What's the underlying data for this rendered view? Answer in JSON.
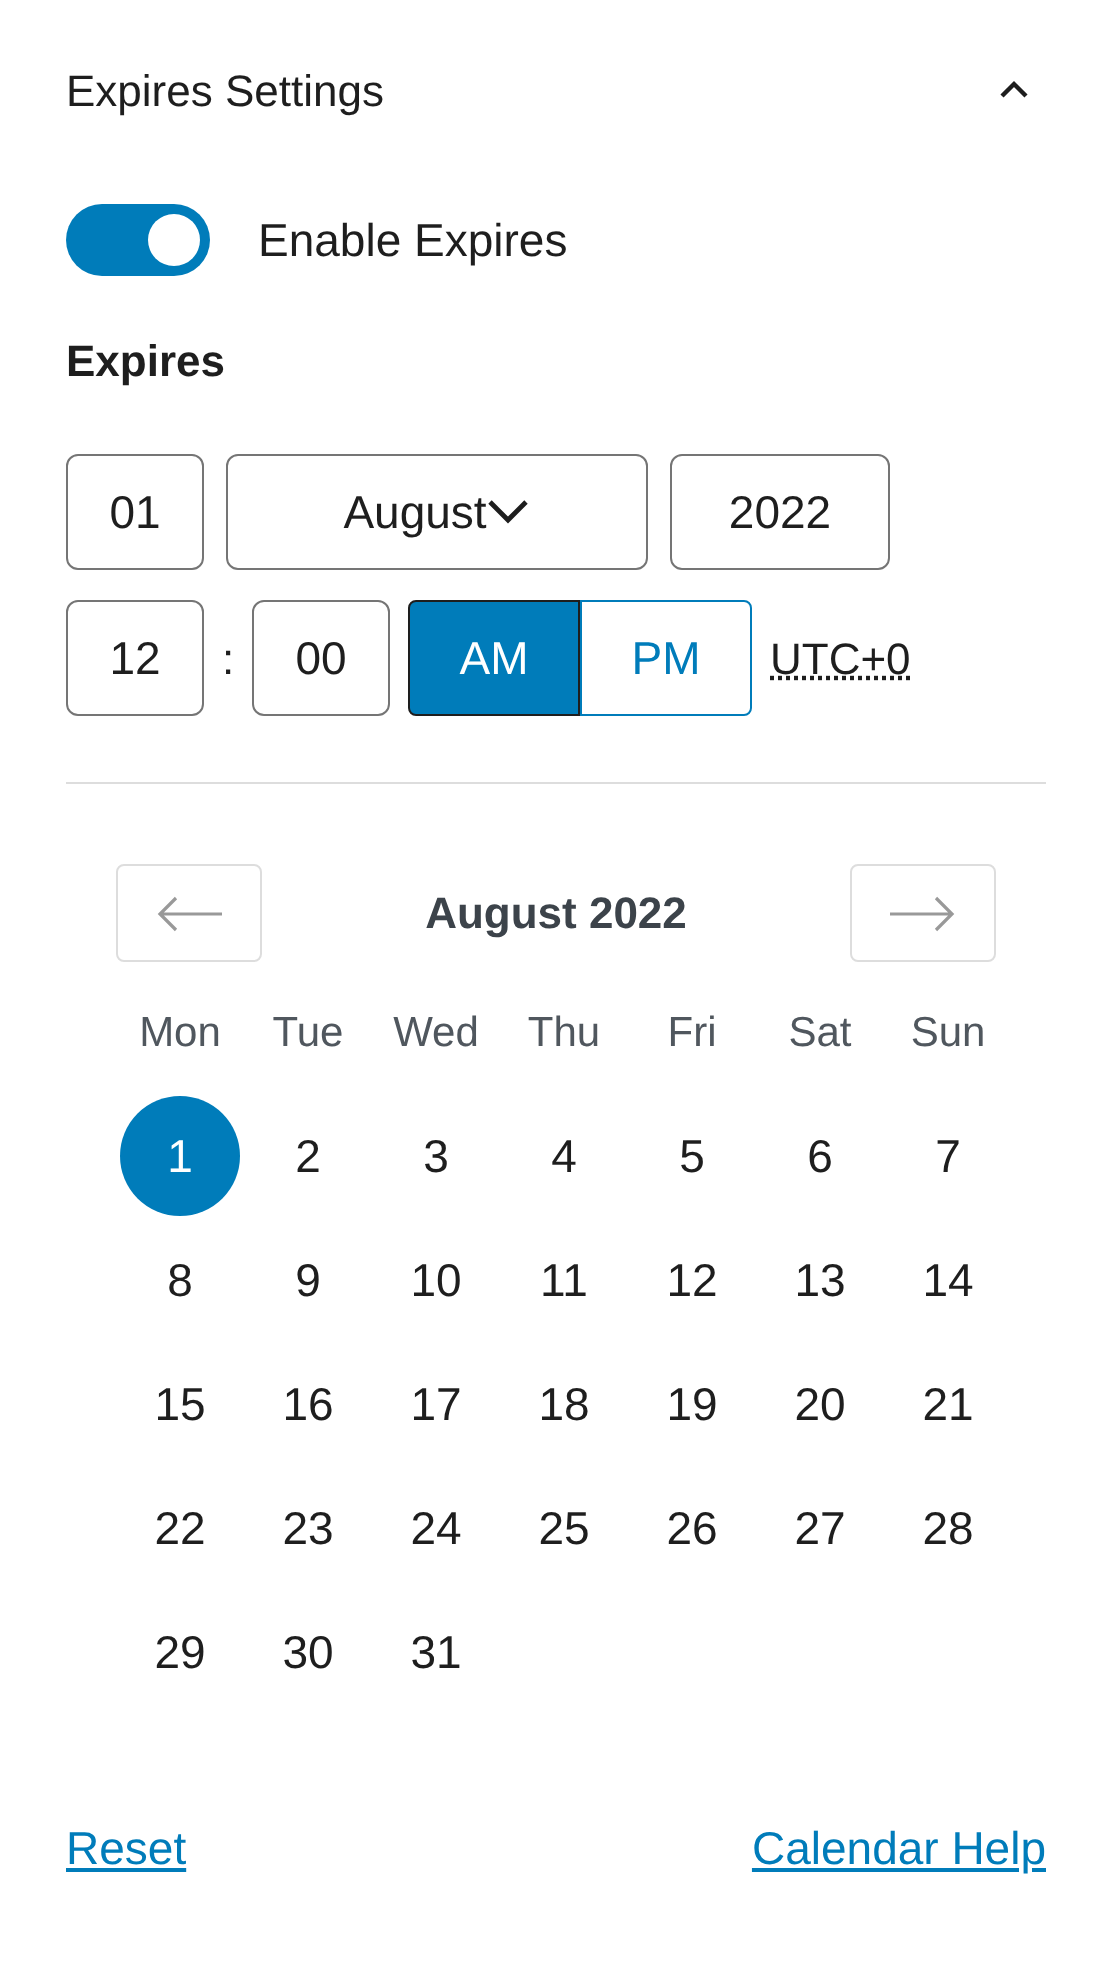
{
  "panel": {
    "title": "Expires Settings",
    "expanded": true
  },
  "toggle": {
    "label": "Enable Expires",
    "on": true
  },
  "section_label": "Expires",
  "date": {
    "day": "01",
    "month": "August",
    "year": "2022"
  },
  "time": {
    "hour": "12",
    "separator": ":",
    "minute": "00",
    "periods": [
      {
        "label": "AM",
        "selected": true
      },
      {
        "label": "PM",
        "selected": false
      }
    ],
    "timezone": "UTC+0"
  },
  "calendar": {
    "title": "August 2022",
    "weekdays": [
      "Mon",
      "Tue",
      "Wed",
      "Thu",
      "Fri",
      "Sat",
      "Sun"
    ],
    "weeks": [
      [
        {
          "day": "1",
          "selected": true
        },
        {
          "day": "2",
          "selected": false
        },
        {
          "day": "3",
          "selected": false
        },
        {
          "day": "4",
          "selected": false
        },
        {
          "day": "5",
          "selected": false
        },
        {
          "day": "6",
          "selected": false
        },
        {
          "day": "7",
          "selected": false
        }
      ],
      [
        {
          "day": "8",
          "selected": false
        },
        {
          "day": "9",
          "selected": false
        },
        {
          "day": "10",
          "selected": false
        },
        {
          "day": "11",
          "selected": false
        },
        {
          "day": "12",
          "selected": false
        },
        {
          "day": "13",
          "selected": false
        },
        {
          "day": "14",
          "selected": false
        }
      ],
      [
        {
          "day": "15",
          "selected": false
        },
        {
          "day": "16",
          "selected": false
        },
        {
          "day": "17",
          "selected": false
        },
        {
          "day": "18",
          "selected": false
        },
        {
          "day": "19",
          "selected": false
        },
        {
          "day": "20",
          "selected": false
        },
        {
          "day": "21",
          "selected": false
        }
      ],
      [
        {
          "day": "22",
          "selected": false
        },
        {
          "day": "23",
          "selected": false
        },
        {
          "day": "24",
          "selected": false
        },
        {
          "day": "25",
          "selected": false
        },
        {
          "day": "26",
          "selected": false
        },
        {
          "day": "27",
          "selected": false
        },
        {
          "day": "28",
          "selected": false
        }
      ],
      [
        {
          "day": "29",
          "selected": false
        },
        {
          "day": "30",
          "selected": false
        },
        {
          "day": "31",
          "selected": false
        }
      ]
    ]
  },
  "links": [
    "Reset",
    "Calendar Help"
  ]
}
